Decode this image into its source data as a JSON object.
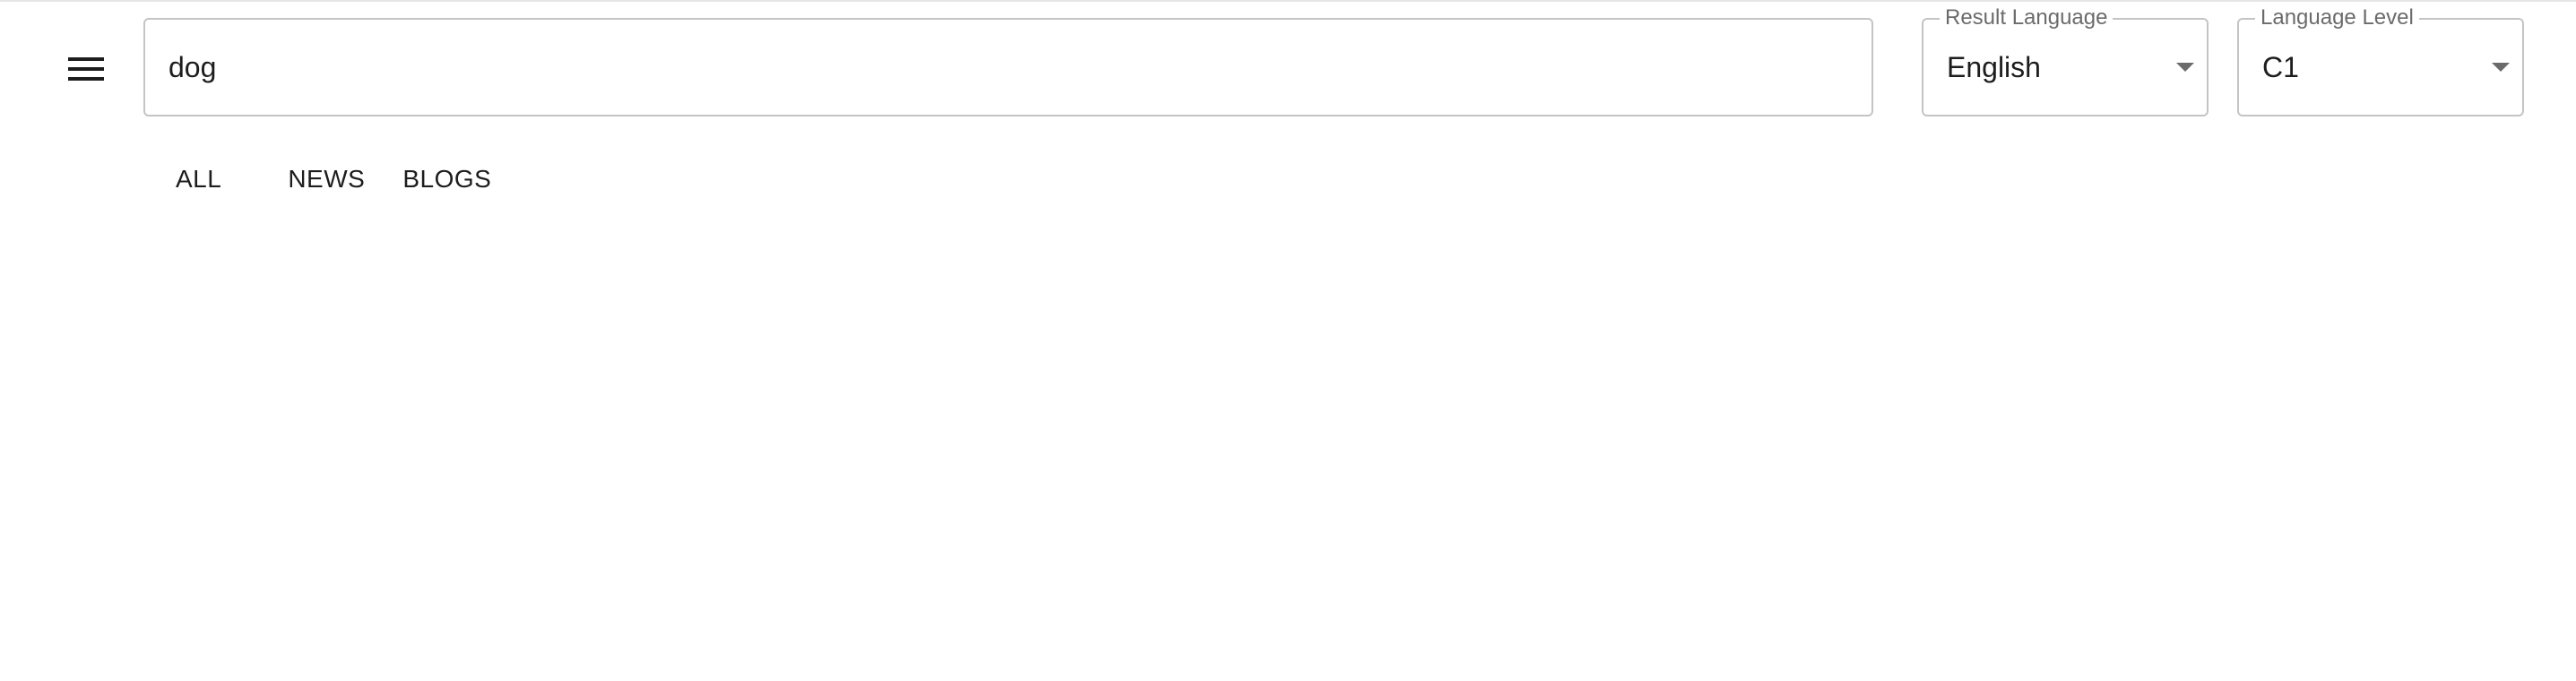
{
  "header": {
    "menu_icon": "menu-icon",
    "search": {
      "value": "dog",
      "placeholder": ""
    },
    "result_language": {
      "label": "Result Language",
      "value": "English",
      "icon": "caret-down-icon"
    },
    "language_level": {
      "label": "Language Level",
      "value": "C1",
      "icon": "caret-down-icon"
    }
  },
  "tabs": [
    {
      "label": "ALL"
    },
    {
      "label": "NEWS"
    },
    {
      "label": "BLOGS"
    }
  ],
  "colors": {
    "border": "#c4c4c4",
    "text": "#1d1d1d",
    "muted": "#6b6b6b",
    "background": "#ffffff"
  }
}
